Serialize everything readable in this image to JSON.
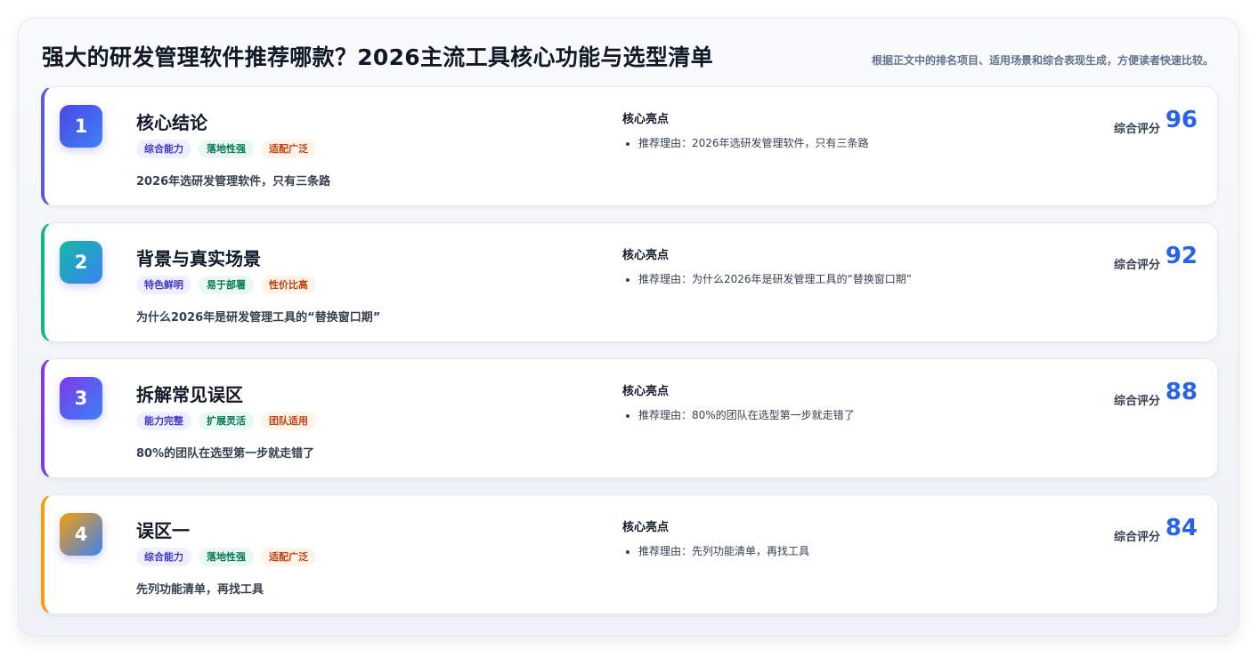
{
  "header": {
    "title": "强大的研发管理软件推荐哪款？2026主流工具核心功能与选型清单",
    "subtitle": "根据正文中的排名项目、适用场景和综合表现生成，方便读者快速比较。"
  },
  "cards": [
    {
      "rank": "1",
      "title": "核心结论",
      "tags": [
        "综合能力",
        "落地性强",
        "适配广泛"
      ],
      "description": "2026年选研发管理软件，只有三条路",
      "highlights_heading": "核心亮点",
      "highlights": [
        "推荐理由：2026年选研发管理软件，只有三条路"
      ],
      "score_label": "综合评分",
      "score": "96",
      "accent": "#5b5bd6",
      "badge_colors": [
        "#4f46e5",
        "#3b82f6"
      ]
    },
    {
      "rank": "2",
      "title": "背景与真实场景",
      "tags": [
        "特色鲜明",
        "易于部署",
        "性价比高"
      ],
      "description": "为什么2026年是研发管理工具的“替换窗口期”",
      "highlights_heading": "核心亮点",
      "highlights": [
        "推荐理由：为什么2026年是研发管理工具的“替换窗口期”"
      ],
      "score_label": "综合评分",
      "score": "92",
      "accent": "#10b981",
      "badge_colors": [
        "#14b8a6",
        "#3b82f6"
      ]
    },
    {
      "rank": "3",
      "title": "拆解常见误区",
      "tags": [
        "能力完整",
        "扩展灵活",
        "团队适用"
      ],
      "description": "80%的团队在选型第一步就走错了",
      "highlights_heading": "核心亮点",
      "highlights": [
        "推荐理由：80%的团队在选型第一步就走错了"
      ],
      "score_label": "综合评分",
      "score": "88",
      "accent": "#7c3aed",
      "badge_colors": [
        "#7c3aed",
        "#3b82f6"
      ]
    },
    {
      "rank": "4",
      "title": "误区一",
      "tags": [
        "综合能力",
        "落地性强",
        "适配广泛"
      ],
      "description": "先列功能清单，再找工具",
      "highlights_heading": "核心亮点",
      "highlights": [
        "推荐理由：先列功能清单，再找工具"
      ],
      "score_label": "综合评分",
      "score": "84",
      "accent": "#f59e0b",
      "badge_colors": [
        "#f59e0b",
        "#3b82f6"
      ]
    }
  ]
}
